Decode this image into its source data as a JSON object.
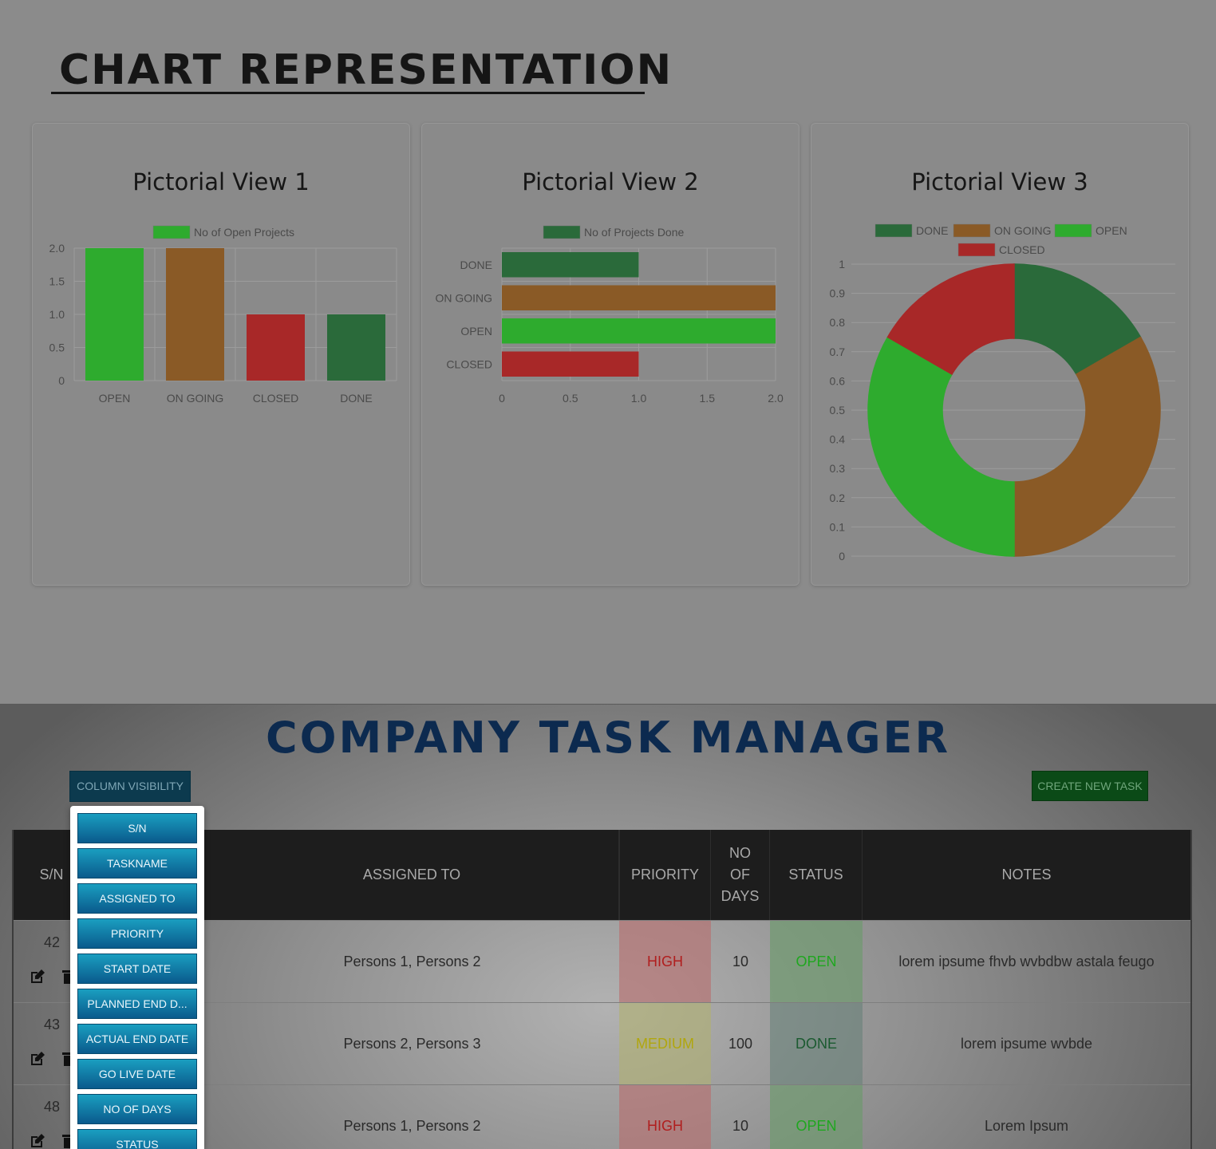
{
  "header": {
    "title": "CHART REPRESENTATION"
  },
  "cards": [
    {
      "title": "Pictorial View 1"
    },
    {
      "title": "Pictorial View 2"
    },
    {
      "title": "Pictorial View 3"
    }
  ],
  "colors": {
    "open": "#2eab2e",
    "ongoing": "#8a5a26",
    "closed": "#a82828",
    "done": "#2a6a3a"
  },
  "chart_data": [
    {
      "type": "bar",
      "title": "Pictorial View 1",
      "categories": [
        "OPEN",
        "ON GOING",
        "CLOSED",
        "DONE"
      ],
      "series": [
        {
          "name": "No of Open Projects",
          "values": [
            2,
            2,
            1,
            1
          ]
        }
      ],
      "bar_colors": [
        "#2eab2e",
        "#8a5a26",
        "#a82828",
        "#2a6a3a"
      ],
      "legend_color": "#2eab2e",
      "ylim": [
        0,
        2
      ],
      "yticks": [
        "0",
        "0.5",
        "1.0",
        "1.5",
        "2.0"
      ],
      "grid": true,
      "legend": "top"
    },
    {
      "type": "bar",
      "orientation": "horizontal",
      "title": "Pictorial View 2",
      "categories": [
        "DONE",
        "ON GOING",
        "OPEN",
        "CLOSED"
      ],
      "series": [
        {
          "name": "No of Projects Done",
          "values": [
            1,
            2,
            2,
            1
          ]
        }
      ],
      "bar_colors": [
        "#2a6a3a",
        "#8a5a26",
        "#2eab2e",
        "#a82828"
      ],
      "legend_color": "#2a6a3a",
      "xlim": [
        0,
        2
      ],
      "xticks": [
        "0",
        "0.5",
        "1.0",
        "1.5",
        "2.0"
      ],
      "grid": true,
      "legend": "top"
    },
    {
      "type": "pie",
      "title": "Pictorial View 3",
      "categories": [
        "DONE",
        "ON GOING",
        "OPEN",
        "CLOSED"
      ],
      "values": [
        1,
        2,
        2,
        1
      ],
      "slice_colors": [
        "#2a6a3a",
        "#8a5a26",
        "#2eab2e",
        "#a82828"
      ],
      "yticks": [
        "0",
        "0.1",
        "0.2",
        "0.3",
        "0.4",
        "0.5",
        "0.6",
        "0.7",
        "0.8",
        "0.9",
        "1"
      ],
      "grid": true,
      "legend": "top"
    }
  ],
  "task_manager": {
    "title": "COMPANY TASK MANAGER",
    "column_visibility_label": "COLUMN VISIBILITY",
    "create_task_label": "CREATE NEW TASK",
    "headers": {
      "sn": "S/N",
      "assigned_to": "ASSIGNED TO",
      "priority": "PRIORITY",
      "no_of_days_line1": "NO",
      "no_of_days_line2": "OF",
      "no_of_days_line3": "DAYS",
      "status": "STATUS",
      "notes": "NOTES"
    },
    "rows": [
      {
        "sn": "42",
        "assigned_to": "Persons 1, Persons 2",
        "priority": "HIGH",
        "days": "10",
        "status": "OPEN",
        "notes": "lorem ipsume fhvb wvbdbw astala feugo"
      },
      {
        "sn": "43",
        "assigned_to": "Persons 2, Persons 3",
        "priority": "MEDIUM",
        "days": "100",
        "status": "DONE",
        "notes": "lorem ipsume wvbde"
      },
      {
        "sn": "48",
        "assigned_to": "Persons 1, Persons 2",
        "priority": "HIGH",
        "days": "10",
        "status": "OPEN",
        "notes": "Lorem Ipsum"
      }
    ],
    "column_menu": [
      "S/N",
      "TASKNAME",
      "ASSIGNED TO",
      "PRIORITY",
      "START DATE",
      "PLANNED END D...",
      "ACTUAL END DATE",
      "GO LIVE DATE",
      "NO OF DAYS",
      "STATUS"
    ]
  }
}
